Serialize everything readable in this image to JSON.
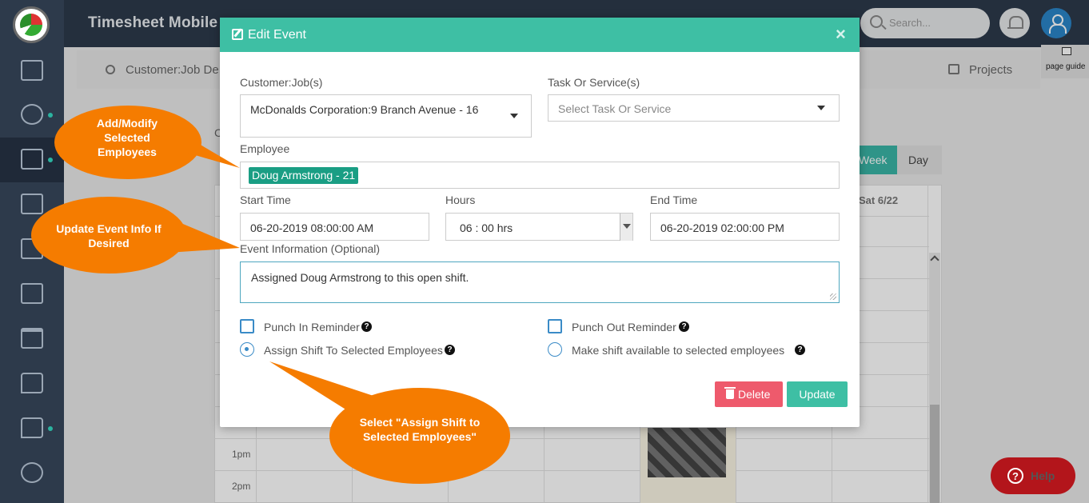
{
  "app": {
    "title": "Timesheet Mobile"
  },
  "header": {
    "search_placeholder": "Search...",
    "page_guide_label": "page guide"
  },
  "background": {
    "customer_label": "Customer:Job De",
    "projects_label": "Projects",
    "c_stub": "C",
    "week_label": "Week",
    "day_label": "Day",
    "sat_label": "Sat 6/22",
    "hours": [
      "1pm",
      "2pm"
    ]
  },
  "modal": {
    "title": "Edit Event",
    "close_label": "×",
    "customer_job": {
      "label": "Customer:Job(s)",
      "value": "McDonalds Corporation:9 Branch Avenue - 16"
    },
    "task": {
      "label": "Task Or Service(s)",
      "placeholder": "Select Task Or Service"
    },
    "employee": {
      "label": "Employee",
      "selected": "Doug Armstrong - 21"
    },
    "start_time": {
      "label": "Start Time",
      "value": "06-20-2019 08:00:00 AM"
    },
    "hours": {
      "label": "Hours",
      "value": "06 : 00 hrs"
    },
    "end_time": {
      "label": "End Time",
      "value": "06-20-2019 02:00:00 PM"
    },
    "event_info": {
      "label": "Event Information (Optional)",
      "value": "Assigned Doug Armstrong to this open shift."
    },
    "punch_in": {
      "label": "Punch In Reminder",
      "checked": false
    },
    "punch_out": {
      "label": "Punch Out Reminder",
      "checked": false
    },
    "assign_shift": {
      "label": "Assign Shift To Selected Employees",
      "selected": true
    },
    "make_available": {
      "label": "Make shift available to selected employees",
      "selected": false
    },
    "delete_label": "Delete",
    "update_label": "Update"
  },
  "callouts": {
    "employees": "Add/Modify Selected Employees",
    "event_info": "Update Event Info If Desired",
    "assign": "Select \"Assign Shift to Selected Employees\""
  },
  "help": {
    "label": "Help",
    "icon_text": "?"
  },
  "colors": {
    "accent": "#3ebfa4",
    "sidebar": "#2d3a4b",
    "delete": "#ee5a6c",
    "help": "#b3151b",
    "callout": "#f57c00"
  }
}
